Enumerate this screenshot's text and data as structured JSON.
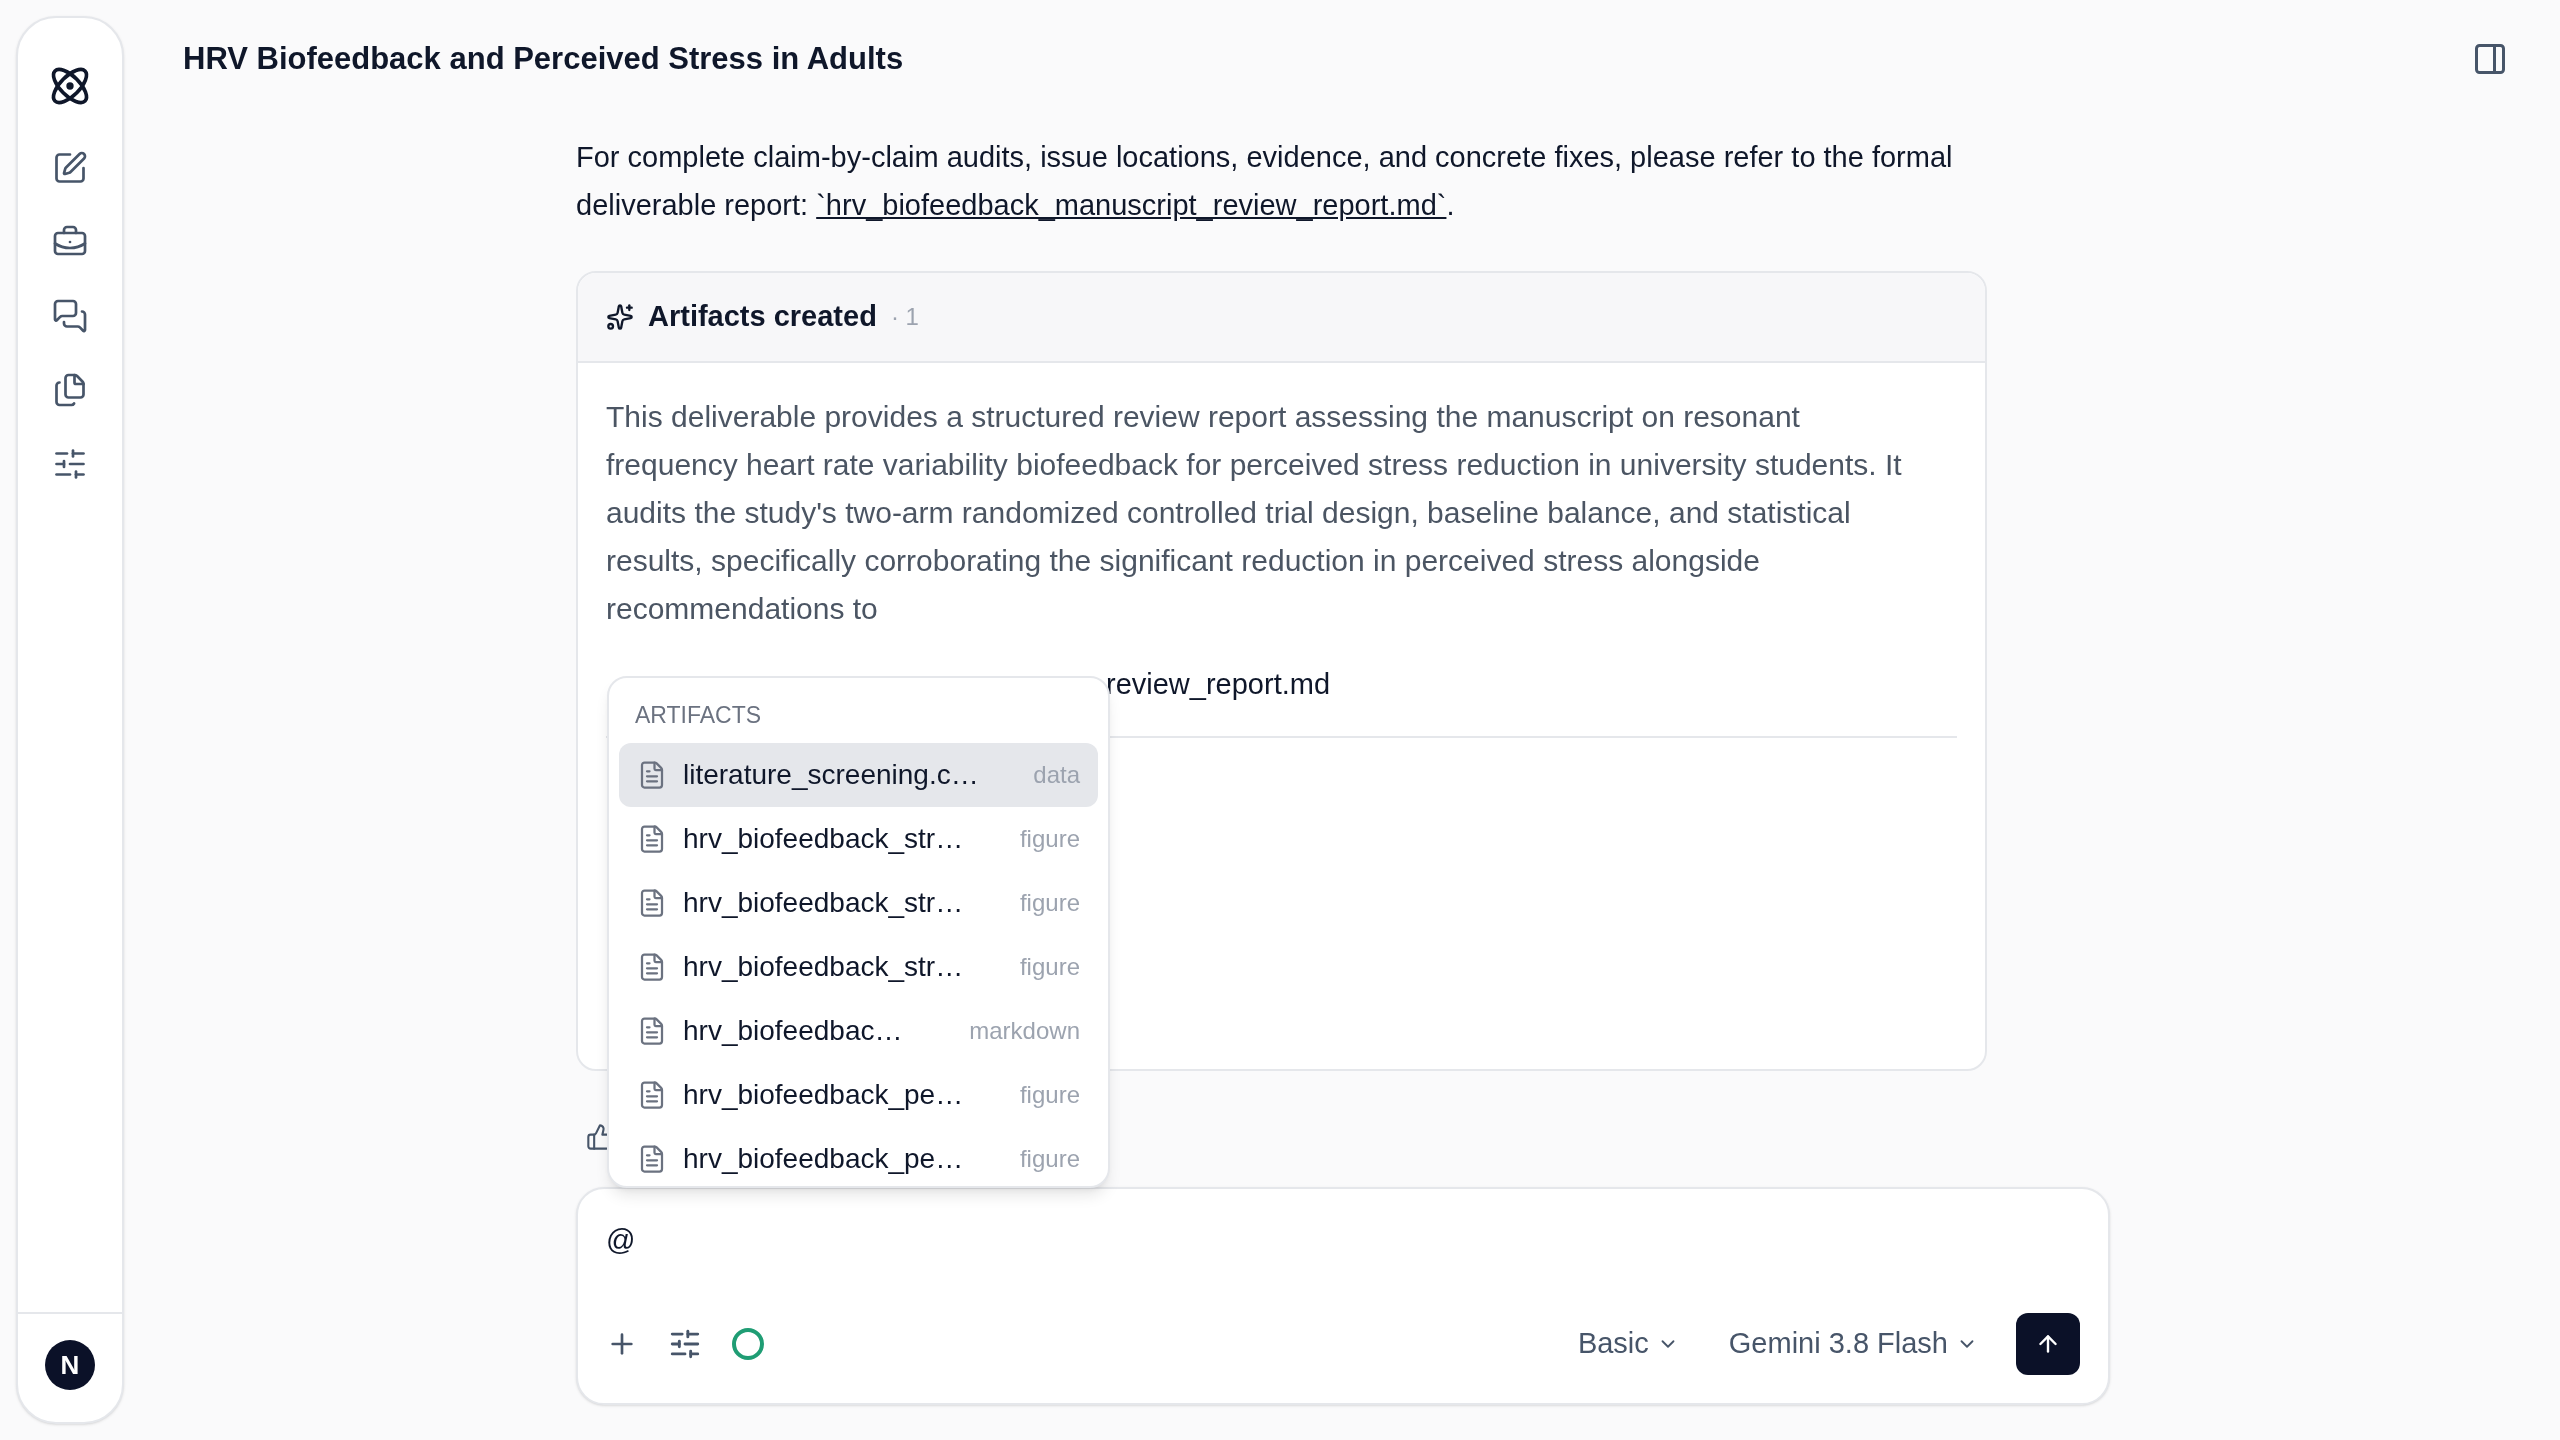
{
  "header": {
    "title": "HRV Biofeedback and Perceived Stress in Adults"
  },
  "message": {
    "paragraph": "For complete claim-by-claim audits, issue locations, evidence, and concrete fixes, please refer to the formal deliverable report: ",
    "link": "`hrv_biofeedback_manuscript_review_report.md`",
    "tail": "."
  },
  "artifacts_card": {
    "title": "Artifacts created",
    "count": "· 1",
    "description": "This deliverable provides a structured review report assessing the manuscript on resonant frequency heart rate variability biofeedback for perceived stress reduction in university students. It audits the study's two-arm randomized controlled trial design, baseline balance, and statistical results, specifically corroborating the significant reduction in perceived stress alongside recommendations to",
    "file_name": "review_report.md"
  },
  "mention_menu": {
    "heading": "ARTIFACTS",
    "items": [
      {
        "name": "literature_screening.c…",
        "type": "data",
        "selected": true
      },
      {
        "name": "hrv_biofeedback_str…",
        "type": "figure",
        "selected": false
      },
      {
        "name": "hrv_biofeedback_str…",
        "type": "figure",
        "selected": false
      },
      {
        "name": "hrv_biofeedback_str…",
        "type": "figure",
        "selected": false
      },
      {
        "name": "hrv_biofeedbac…",
        "type": "markdown",
        "selected": false
      },
      {
        "name": "hrv_biofeedback_pe…",
        "type": "figure",
        "selected": false
      },
      {
        "name": "hrv_biofeedback_pe…",
        "type": "figure",
        "selected": false
      }
    ]
  },
  "composer": {
    "value": "@",
    "mode": "Basic",
    "model": "Gemini 3.8 Flash"
  },
  "user": {
    "initial": "N"
  }
}
